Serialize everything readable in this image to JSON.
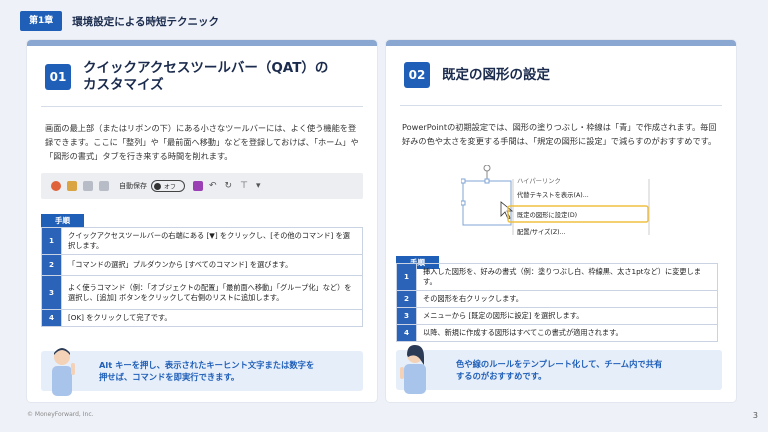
{
  "chapter": {
    "tag": "第1章",
    "title": "環境設定による時短テクニック"
  },
  "left": {
    "num": "01",
    "title_line1": "クイックアクセスツールバー（QAT）の",
    "title_line2": "カスタマイズ",
    "description": "画面の最上部（またはリボンの下）にある小さなツールバーには、よく使う機能を登録できます。ここに「整列」や「最前面へ移動」などを登録しておけば、「ホーム」や「図形の書式」タブを行き来する時間を削れます。",
    "toolbar": {
      "autosave": "自動保存",
      "toggle": "オフ"
    },
    "steps_label": "手順",
    "steps": [
      {
        "n": "1",
        "text": "クイックアクセスツールバーの右端にある [▼] をクリックし、[その他のコマンド] を選択します。"
      },
      {
        "n": "2",
        "text": "「コマンドの選択」プルダウンから [すべてのコマンド] を選びます。"
      },
      {
        "n": "3",
        "text": "よく使うコマンド（例：「オブジェクトの配置」「最前面へ移動」「グループ化」など）を選択し、[追加] ボタンをクリックして右側のリストに追加します。"
      },
      {
        "n": "4",
        "text": "[OK] をクリックして完了です。"
      }
    ],
    "tip_line1": "Alt キーを押し、表示されたキーヒント文字または数字を",
    "tip_line2": "押せば、コマンドを即実行できます。"
  },
  "right": {
    "num": "02",
    "title": "既定の図形の設定",
    "description": "PowerPointの初期設定では、図形の塗りつぶし・枠線は「青」で作成されます。毎回好みの色や太さを変更する手間は、「規定の図形に設定」で減らすのがおすすめです。",
    "menu": {
      "item0": "ハイパーリンク",
      "item1": "代替テキストを表示(A)...",
      "item2": "既定の図形に設定(D)",
      "item3": "配置/サイズ(Z)..."
    },
    "steps_label": "手順",
    "steps": [
      {
        "n": "1",
        "text": "挿入した図形を、好みの書式（例：塗りつぶし白、枠線黒、太さ1ptなど）に変更します。"
      },
      {
        "n": "2",
        "text": "その図形を右クリックします。"
      },
      {
        "n": "3",
        "text": "メニューから [既定の図形に設定] を選択します。"
      },
      {
        "n": "4",
        "text": "以降、新規に作成する図形はすべてこの書式が適用されます。"
      }
    ],
    "tip_line1": "色や線のルールをテンプレート化して、チーム内で共有",
    "tip_line2": "するのがおすすめです。"
  },
  "footer": "© MoneyForward, Inc.",
  "page_number": "3",
  "colors": {
    "accent": "#1f5fb8",
    "card_top": "#8aa7d2",
    "tip_bg": "#e6eefa",
    "highlight": "#f0c040"
  }
}
